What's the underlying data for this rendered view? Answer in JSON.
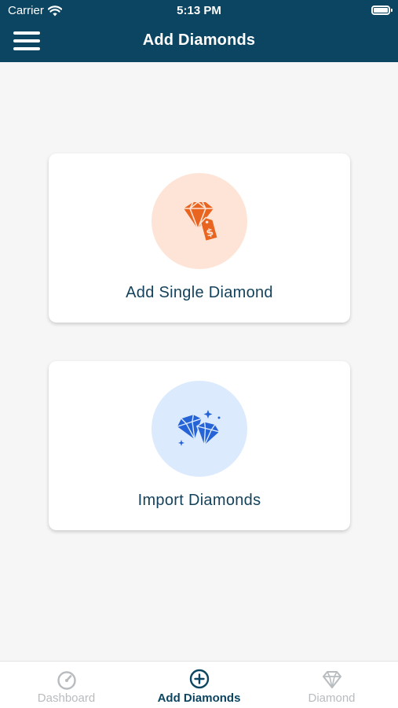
{
  "status_bar": {
    "carrier": "Carrier",
    "time": "5:13 PM"
  },
  "header": {
    "title": "Add Diamonds",
    "menu_icon": "hamburger-menu-icon"
  },
  "cards": [
    {
      "label": "Add Single Diamond",
      "icon": "diamond-price-tag-icon",
      "icon_color": "#e8641f",
      "circle_color": "#fde4d6"
    },
    {
      "label": "Import Diamonds",
      "icon": "diamonds-sparkle-icon",
      "icon_color": "#2563d6",
      "circle_color": "#dbeafc"
    }
  ],
  "tabbar": {
    "tabs": [
      {
        "label": "Dashboard",
        "icon": "speedometer-icon",
        "active": false
      },
      {
        "label": "Add Diamonds",
        "icon": "plus-circle-icon",
        "active": true
      },
      {
        "label": "Diamond",
        "icon": "diamond-outline-icon",
        "active": false
      }
    ]
  },
  "colors": {
    "header_bg": "#0b4561",
    "page_bg": "#f6f6f6",
    "label_text": "#14425c",
    "inactive_tab": "#b8bcbf"
  }
}
